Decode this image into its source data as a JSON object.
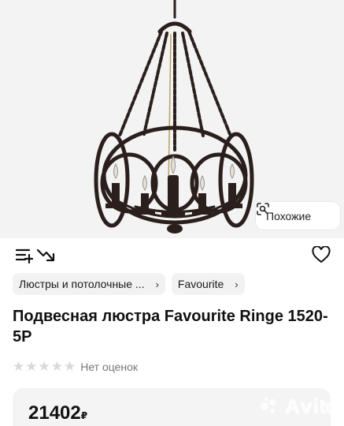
{
  "similar_button": {
    "label": "Похожие",
    "icon": "image-search-icon"
  },
  "actions": {
    "add_to_list_icon": "list-add-icon",
    "price_drop_icon": "price-drop-icon",
    "favorite_icon": "heart-icon"
  },
  "breadcrumbs": [
    {
      "label": "Люстры и потолочные ...",
      "chevron": "›"
    },
    {
      "label": "Favourite",
      "chevron": "›"
    }
  ],
  "product": {
    "title": "Подвесная люстра Favourite Ringe 1520-5P",
    "rating_text": "Нет оценок",
    "stars": [
      "★",
      "★",
      "★",
      "★",
      "★"
    ],
    "price": "21402",
    "currency": "₽"
  },
  "watermark": {
    "text": "Avito"
  },
  "colors": {
    "accent": "#111111",
    "chip_bg": "#f2f2f2",
    "card_bg": "#f4f4f4",
    "star_empty": "#d9d9d9"
  }
}
